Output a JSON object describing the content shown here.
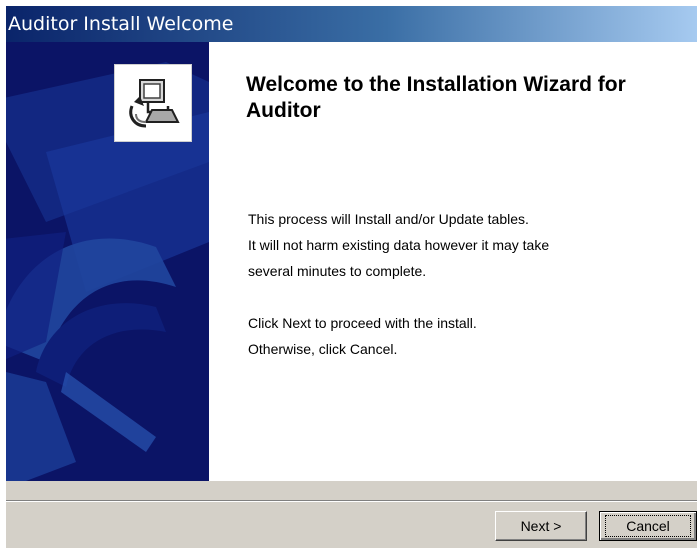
{
  "window": {
    "title": "Auditor Install Welcome"
  },
  "wizard": {
    "heading": "Welcome to the Installation Wizard for Auditor",
    "paragraph1": [
      "This process will Install and/or Update tables.",
      "It will not harm existing data however it may take",
      "several minutes to complete."
    ],
    "paragraph2": [
      "Click Next to proceed with the install.",
      "Otherwise, click Cancel."
    ],
    "icon": "computer-install-icon"
  },
  "buttons": {
    "next_label": "Next >",
    "cancel_label": "Cancel"
  },
  "colors": {
    "titlebar_start": "#0a246a",
    "titlebar_end": "#a6caf0",
    "side_panel": "#0b1466",
    "dialog_face": "#d4d0c8"
  }
}
